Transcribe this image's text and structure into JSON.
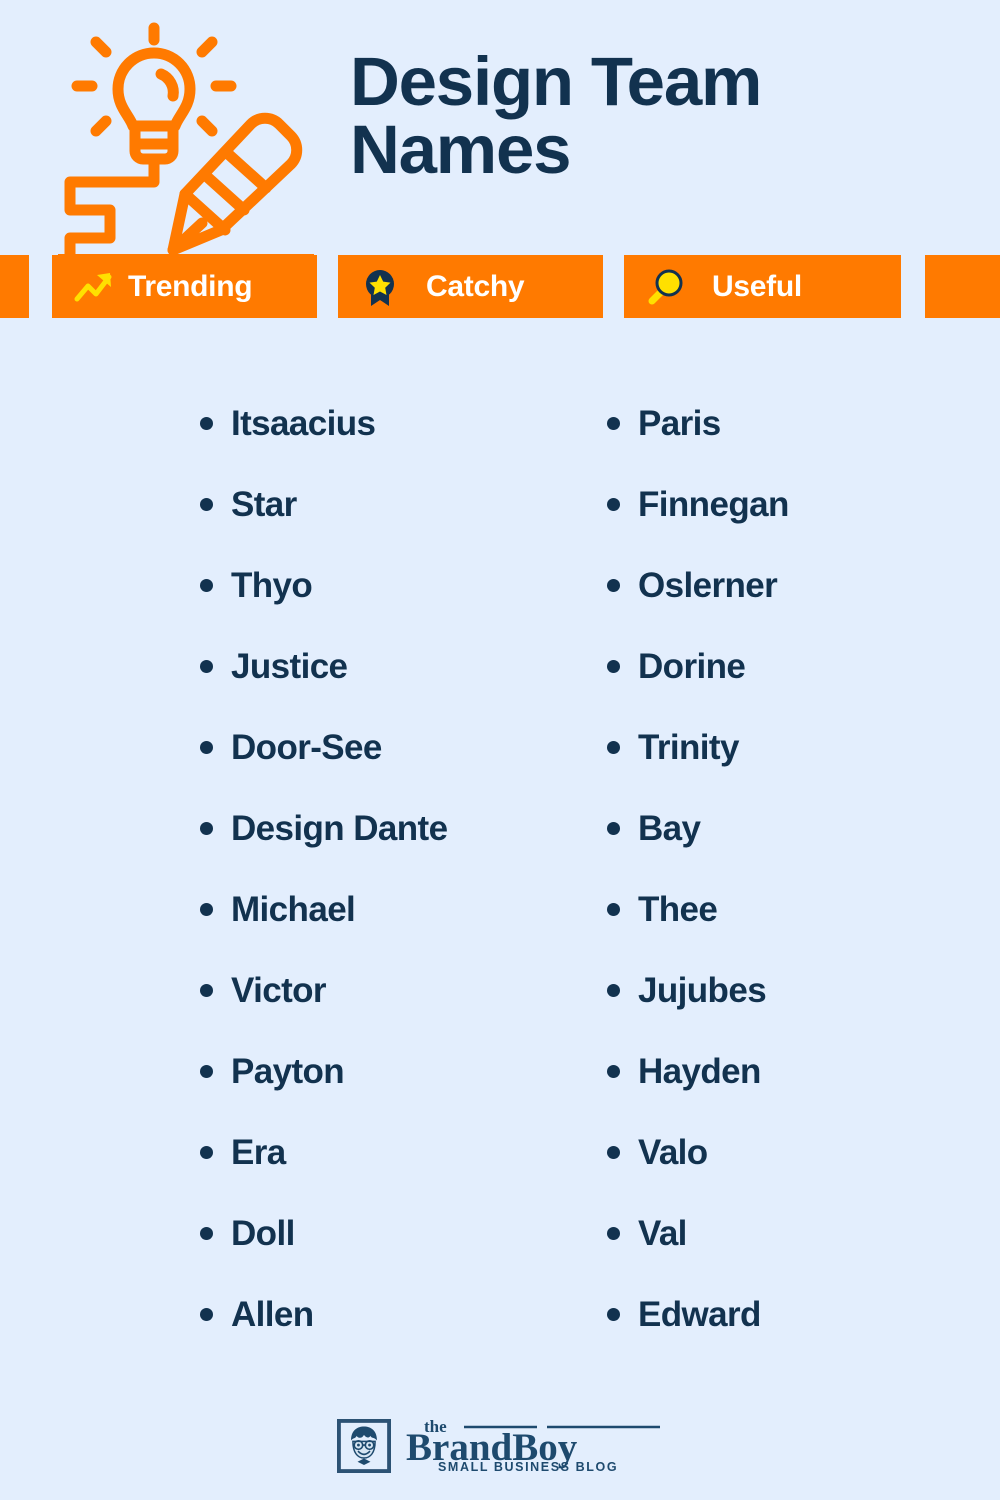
{
  "theme": {
    "background": "#e3eefd",
    "navy": "#12324f",
    "orange": "#ff7a00",
    "yellow": "#ffe000",
    "white": "#ffffff"
  },
  "header": {
    "title": "Design Team Names",
    "title_line1": "Design Team",
    "title_line2": "Names",
    "logo_icon": "lightbulb-pencil-icon"
  },
  "badges": [
    {
      "label": "Trending",
      "icon": "trending-up-arrow-icon"
    },
    {
      "label": "Catchy",
      "icon": "star-award-badge-icon"
    },
    {
      "label": "Useful",
      "icon": "magnifying-glass-icon"
    }
  ],
  "lists": {
    "left_column": [
      "Itsaacius",
      "Star",
      "Thyo",
      "Justice",
      "Door-See",
      "Design Dante",
      "Michael",
      "Victor",
      "Payton",
      "Era",
      "Doll",
      "Allen"
    ],
    "right_column": [
      "Paris",
      "Finnegan",
      "Oslerner",
      "Dorine",
      "Trinity",
      "Bay",
      "Thee",
      "Jujubes",
      "Hayden",
      "Valo",
      "Val",
      "Edward"
    ]
  },
  "footer": {
    "logo_prefix": "the",
    "logo_name": "BrandBoy",
    "logo_tagline": "SMALL BUSINESS BLOG",
    "logo_mark_icon": "boy-with-glasses-icon"
  }
}
